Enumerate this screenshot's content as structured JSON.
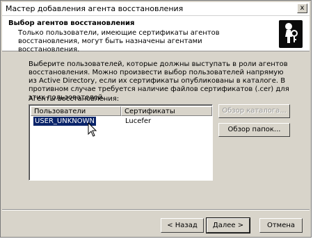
{
  "window": {
    "title": "Мастер добавления агента восстановления",
    "close_glyph": "x"
  },
  "header": {
    "title": "Выбор агентов восстановления",
    "subtitle": "Только пользователи, имеющие сертификаты агентов восстановления, могут быть назначены агентами восстановления.",
    "icon": "agent-key-icon"
  },
  "body": {
    "description": "Выберите пользователей, которые должны выступать в роли агентов восстановления. Можно произвести выбор пользователей напрямую из Active Directory, если их сертификаты опубликованы в каталоге. В противном случае требуется наличие файлов сертификатов (.cer) для этих пользователей.",
    "list_label": "Агенты восстановления:"
  },
  "list": {
    "columns": [
      "Пользователи",
      "Сертификаты"
    ],
    "rows": [
      {
        "user": "USER_UNKNOWN",
        "certificate": "Lucefer",
        "selected": true
      }
    ]
  },
  "side_buttons": {
    "browse_directory": "Обзор каталога...",
    "browse_folders": "Обзор папок..."
  },
  "footer": {
    "back_label": "< Назад",
    "next_label": "Далее >",
    "cancel_label": "Отмена"
  },
  "colors": {
    "selection": "#0a246a",
    "face": "#d8d4ca"
  }
}
